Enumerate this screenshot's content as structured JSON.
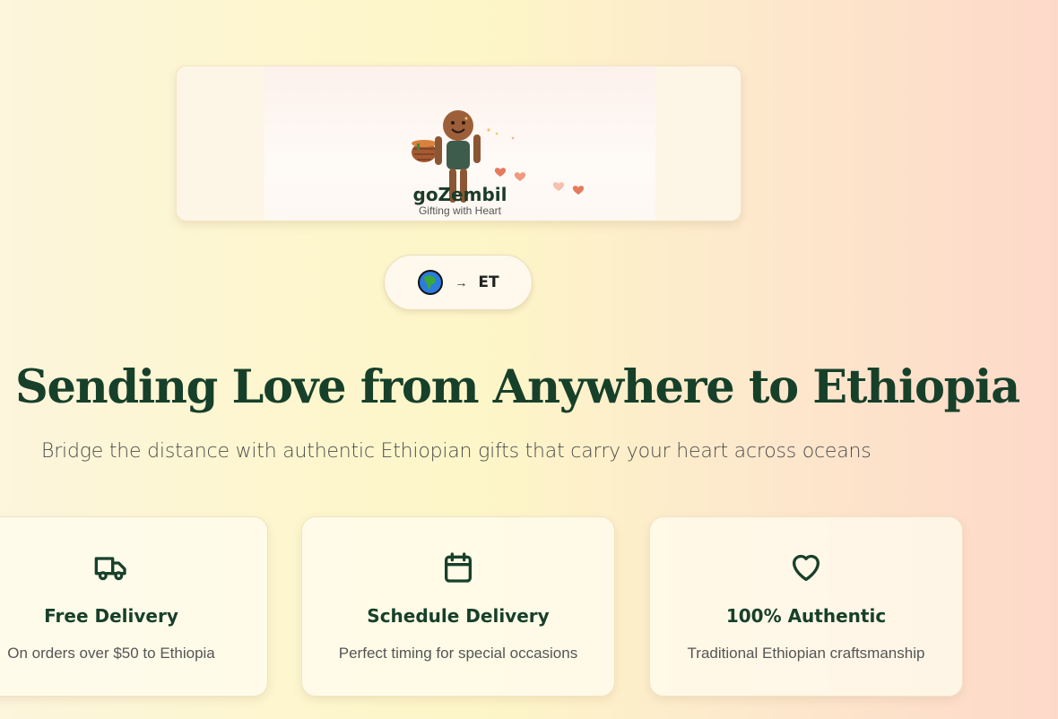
{
  "brand": {
    "name": "goZembil",
    "tagline": "Gifting with Heart"
  },
  "locale": {
    "globe_icon": "globe-icon",
    "arrow": "→",
    "country_code": "ET"
  },
  "hero": {
    "headline": "Sending Love from Anywhere to Ethiopia",
    "subheadline": "Bridge the distance with authentic Ethiopian gifts that carry your heart across oceans"
  },
  "features": [
    {
      "icon": "truck-icon",
      "title": "Free Delivery",
      "description": "On orders over $50 to Ethiopia"
    },
    {
      "icon": "calendar-icon",
      "title": "Schedule Delivery",
      "description": "Perfect timing for special occasions"
    },
    {
      "icon": "heart-icon",
      "title": "100% Authentic",
      "description": "Traditional Ethiopian craftsmanship"
    }
  ],
  "colors": {
    "brand_green": "#17402a",
    "heart_coral": "#e57a5c"
  }
}
